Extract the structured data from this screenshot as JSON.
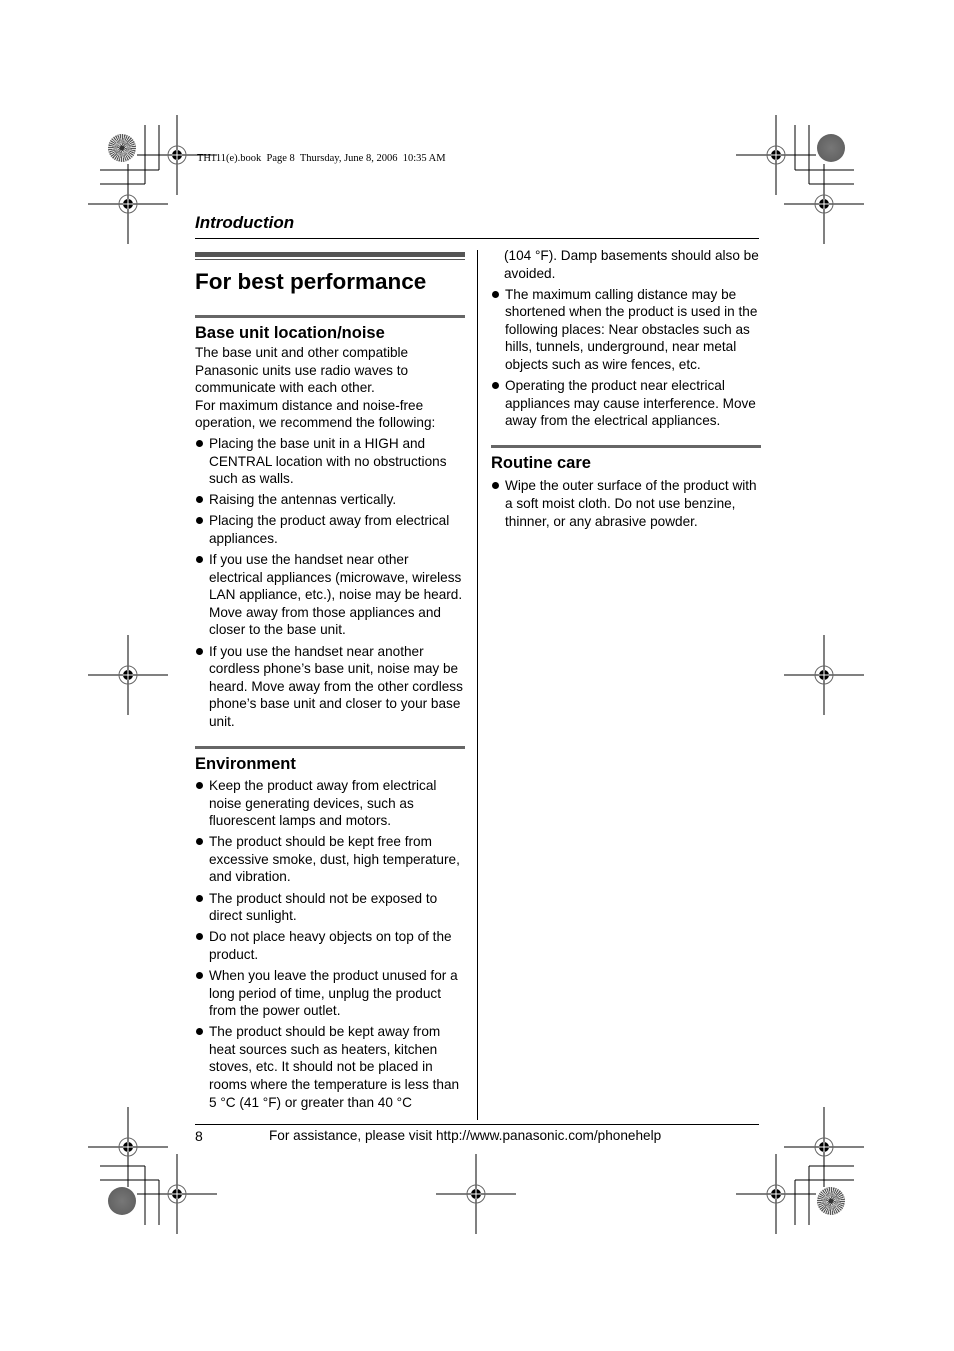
{
  "slug": "TH111(e).book  Page 8  Thursday, June 8, 2006  10:35 AM",
  "section": "Introduction",
  "page_heading": "For best performance",
  "sections": {
    "base_unit": {
      "title": "Base unit location/noise",
      "intro": [
        "The base unit and other compatible Panasonic units use radio waves to communicate with each other.",
        "For maximum distance and noise-free operation, we recommend the following:"
      ],
      "bullets": [
        "Placing the base unit in a HIGH and CENTRAL location with no obstructions such as walls.",
        "Raising the antennas vertically.",
        "Placing the product away from electrical appliances.",
        "If you use the handset near other electrical appliances (microwave, wireless LAN appliance, etc.), noise may be heard. Move away from those appliances and closer to the base unit.",
        "If you use the handset near another cordless phone’s base unit, noise may be heard. Move away from the other cordless phone’s base unit and closer to your base unit."
      ]
    },
    "environment": {
      "title": "Environment",
      "bullets": [
        "Keep the product away from electrical noise generating devices, such as fluorescent lamps and motors.",
        "The product should be kept free from excessive smoke, dust, high temperature, and vibration.",
        "The product should not be exposed to direct sunlight.",
        "Do not place heavy objects on top of the product.",
        "When you leave the product unused for a long period of time, unplug the product from the power outlet.",
        "The product should be kept away from heat sources such as heaters, kitchen stoves, etc. It should not be placed in rooms where the temperature is less than 5 °C (41 °F) or greater than 40 °C"
      ],
      "continuation": "(104 °F). Damp basements should also be avoided.",
      "bullets_cont": [
        "The maximum calling distance may be shortened when the product is used in the following places: Near obstacles such as hills, tunnels, underground, near metal objects such as wire fences, etc.",
        "Operating the product near electrical appliances may cause interference. Move away from the electrical appliances."
      ]
    },
    "routine_care": {
      "title": "Routine care",
      "bullets": [
        "Wipe the outer surface of the product with a soft moist cloth. Do not use benzine, thinner, or any abrasive powder."
      ]
    }
  },
  "footer": {
    "page_number": "8",
    "text": "For assistance, please visit http://www.panasonic.com/phonehelp"
  }
}
